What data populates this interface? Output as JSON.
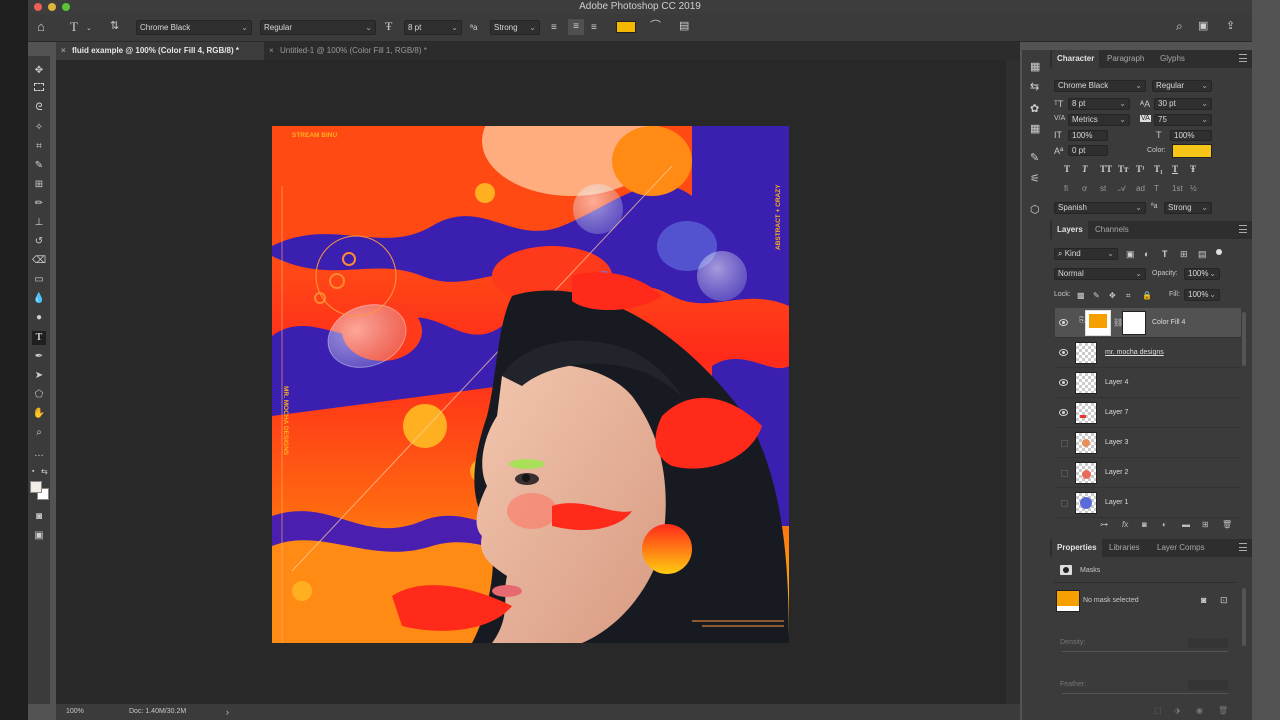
{
  "app": {
    "title": "Adobe Photoshop CC 2019"
  },
  "options_bar": {
    "font_family": "Chrome Black",
    "font_style": "Regular",
    "font_size": "8 pt",
    "aa_symbol": "ªa",
    "antialias": "Strong",
    "text_color": "#f5b800"
  },
  "doc_tabs": [
    {
      "label": "fluid example @ 100% (Color Fill 4, RGB/8) *"
    },
    {
      "label": "Untitled-1 @ 100% (Color Fill 1, RGB/8) *"
    }
  ],
  "status": {
    "zoom": "100%",
    "doc": "Doc: 1.40M/30.2M",
    "arrow": "›"
  },
  "artwork": {
    "brand_top": "STREAM BINU",
    "side_left": "MR. MOCHA DESIGNS",
    "side_right": "ABSTRACT + CRAZY"
  },
  "character_panel": {
    "tabs": [
      "Character",
      "Paragraph",
      "Glyphs"
    ],
    "font_family": "Chrome Black",
    "font_style": "Regular",
    "size": "8 pt",
    "leading": "30 pt",
    "kerning": "Metrics",
    "tracking": "75",
    "vscale": "100%",
    "hscale": "100%",
    "baseline": "0 pt",
    "color_label": "Color:",
    "color": "#f5c518",
    "style_buttons_1": [
      "T",
      "T",
      "TT",
      "Tт",
      "T¹",
      "T₁",
      "T",
      "Ŧ"
    ],
    "style_buttons_2": [
      "ﬁ",
      "ơ",
      "st",
      "𝒜",
      "ad",
      "T",
      "1st",
      "½"
    ],
    "language": "Spanish",
    "aa_symbol": "ªa",
    "antialias": "Strong"
  },
  "layers_panel": {
    "tabs": [
      "Layers",
      "Channels"
    ],
    "filter": "Kind",
    "blend_mode": "Normal",
    "opacity_label": "Opacity:",
    "opacity": "100%",
    "lock_label": "Lock:",
    "fill_label": "Fill:",
    "fill": "100%",
    "layers": [
      {
        "name": "Color Fill 4",
        "visible": true,
        "selected": true
      },
      {
        "name": "mr. mocha designs",
        "visible": true,
        "selected": false
      },
      {
        "name": "Layer 4",
        "visible": true,
        "selected": false
      },
      {
        "name": "Layer 7",
        "visible": true,
        "selected": false
      },
      {
        "name": "Layer 3",
        "visible": false,
        "selected": false
      },
      {
        "name": "Layer 2",
        "visible": false,
        "selected": false
      },
      {
        "name": "Layer 1",
        "visible": false,
        "selected": false
      }
    ],
    "fill_color": "#f5a000"
  },
  "properties_panel": {
    "tabs": [
      "Properties",
      "Libraries",
      "Layer Comps"
    ],
    "masks_label": "Masks",
    "no_mask": "No mask selected",
    "density_label": "Density:",
    "feather_label": "Feather:"
  }
}
